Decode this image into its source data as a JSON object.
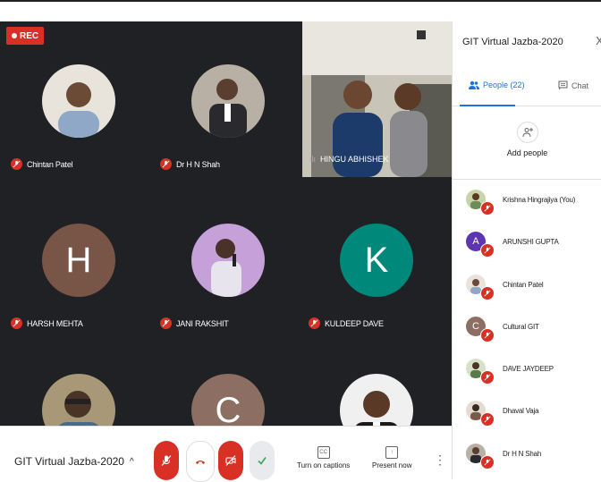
{
  "recording": {
    "label": "REC"
  },
  "grid": {
    "tiles": [
      {
        "name": "Chintan Patel",
        "initial": "",
        "color": "#7a8fa8",
        "photo": true
      },
      {
        "name": "Dr H N Shah",
        "initial": "",
        "color": "#6b6b6b",
        "photo": true
      },
      {
        "name": "HARSH MEHTA",
        "initial": "H",
        "color": "#795548",
        "photo": false
      },
      {
        "name": "JANI RAKSHIT",
        "initial": "",
        "color": "#b39ddb",
        "photo": true
      },
      {
        "name": "KULDEEP DAVE",
        "initial": "K",
        "color": "#00897b",
        "photo": false
      },
      {
        "name": "",
        "initial": "",
        "color": "#8a7a60",
        "photo": true
      },
      {
        "name": "",
        "initial": "C",
        "color": "#8d6e63",
        "photo": false
      },
      {
        "name": "",
        "initial": "",
        "color": "#e0e0e0",
        "photo": true
      }
    ],
    "video": {
      "name": "HINGU ABHISHEK"
    }
  },
  "bar": {
    "meeting_title": "GIT Virtual Jazba-2020",
    "captions_label": "Turn on captions",
    "captions_icon": "CC",
    "present_label": "Present now"
  },
  "panel": {
    "title": "GIT Virtual Jazba-2020",
    "close": "X",
    "tab_people": "People (22)",
    "tab_chat": "Chat",
    "add_people": "Add people",
    "participants": [
      {
        "name": "Krishna Hingrajiya (You)",
        "initial": "",
        "color": "#8d9e6a",
        "photo": true
      },
      {
        "name": "ARUNSHI GUPTA",
        "initial": "A",
        "color": "#5e35b1",
        "photo": false
      },
      {
        "name": "Chintan Patel",
        "initial": "",
        "color": "#7a8fa8",
        "photo": true
      },
      {
        "name": "Cultural GIT",
        "initial": "C",
        "color": "#8d6e63",
        "photo": false
      },
      {
        "name": "DAVE JAYDEEP",
        "initial": "",
        "color": "#6d8c5a",
        "photo": true
      },
      {
        "name": "Dhaval Vaja",
        "initial": "",
        "color": "#7b5a48",
        "photo": true
      },
      {
        "name": "Dr H N Shah",
        "initial": "",
        "color": "#6b6b6b",
        "photo": true
      }
    ]
  },
  "colors": {
    "accent": "#1a73e8",
    "mute_red": "#d93025",
    "grid_bg": "#202124"
  }
}
